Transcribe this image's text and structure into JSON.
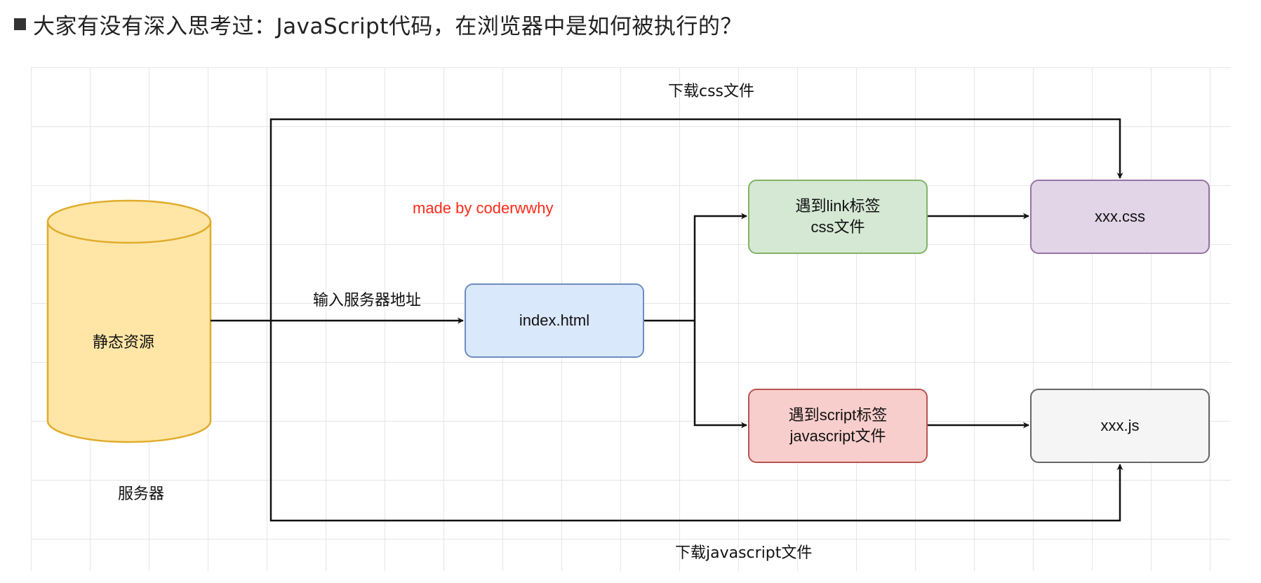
{
  "header": {
    "bullet_icon": "black-square-bullet",
    "title": "大家有没有深入思考过：JavaScript代码，在浏览器中是如何被执行的？"
  },
  "diagram": {
    "server": {
      "cylinder_label": "静态资源",
      "caption": "服务器",
      "fill": "#ffe6a7",
      "stroke": "#e0ac2c"
    },
    "nodes": {
      "index": {
        "text": "index.html"
      },
      "link": {
        "line1": "遇到link标签",
        "line2": "css文件"
      },
      "script": {
        "line1": "遇到script标签",
        "line2": "javascript文件"
      },
      "css": {
        "text": "xxx.css"
      },
      "js": {
        "text": "xxx.js"
      }
    },
    "edge_labels": {
      "input_address": "输入服务器地址",
      "download_css": "下载css文件",
      "download_js": "下载javascript文件"
    },
    "watermark": "made by coderwwhy"
  },
  "colors": {
    "index_fill": "#dae8fc",
    "link_fill": "#d5e8d4",
    "script_fill": "#f8cecc",
    "css_fill": "#e1d5e7",
    "js_fill": "#f5f5f5",
    "watermark": "#ff2a1a"
  }
}
